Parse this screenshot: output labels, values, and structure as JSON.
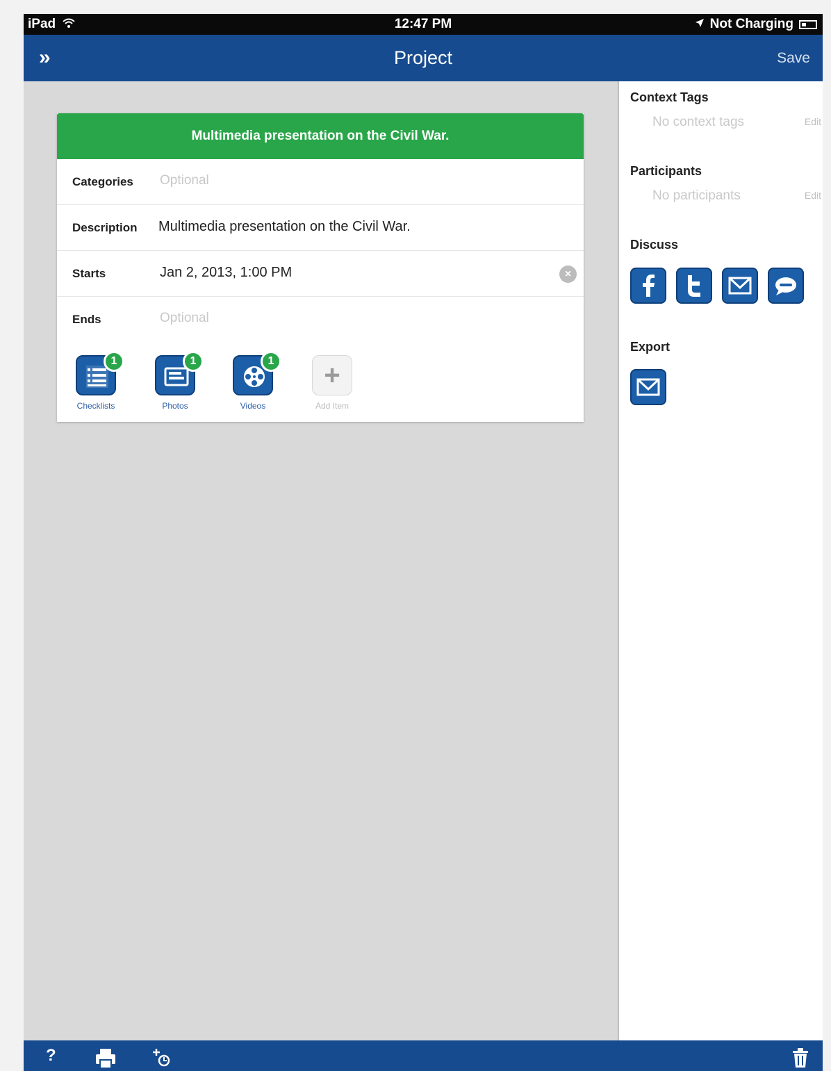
{
  "status_bar": {
    "device": "iPad",
    "time": "12:47 PM",
    "charging": "Not Charging",
    "icons": [
      "wifi-icon",
      "location-arrow-icon",
      "battery-icon"
    ]
  },
  "nav": {
    "menu_icon": "double-chevron-right-icon",
    "menu_glyph": "»",
    "title": "Project",
    "save_label": "Save"
  },
  "card": {
    "header": "Multimedia presentation on the Civil War.",
    "rows": [
      {
        "label": "Categories",
        "value": "Optional",
        "placeholder": true
      },
      {
        "label": "Description",
        "value": "Multimedia presentation on the Civil War.",
        "placeholder": false
      },
      {
        "label": "Starts",
        "value": "Jan 2, 2013, 1:00 PM",
        "placeholder": false
      },
      {
        "label": "Ends",
        "value": "Optional",
        "placeholder": true
      }
    ],
    "clear_glyph": "×",
    "attachments": [
      {
        "label": "Checklists",
        "count": "1",
        "icon": "checklist-icon"
      },
      {
        "label": "Photos",
        "count": "1",
        "icon": "photo-icon"
      },
      {
        "label": "Videos",
        "count": "1",
        "icon": "film-reel-icon"
      },
      {
        "label": "Add Item",
        "icon": "plus-icon",
        "glyph": "+"
      }
    ]
  },
  "panel": {
    "context_tags": {
      "title": "Context Tags",
      "value": "No context tags",
      "edit": "Edit"
    },
    "participants": {
      "title": "Participants",
      "value": "No participants",
      "edit": "Edit"
    },
    "discuss": {
      "title": "Discuss",
      "icons": [
        "facebook-icon",
        "twitter-icon",
        "mail-icon",
        "message-icon"
      ]
    },
    "export": {
      "title": "Export",
      "icons": [
        "mail-icon"
      ]
    }
  },
  "toolbar": {
    "help_glyph": "?",
    "icons": [
      "help-icon",
      "print-icon",
      "add-context-icon",
      "trash-icon"
    ]
  },
  "colors": {
    "nav_blue": "#174b8f",
    "header_green": "#2aa64a",
    "icon_blue": "#1c5fa8",
    "content_gray": "#d9d9d9"
  }
}
